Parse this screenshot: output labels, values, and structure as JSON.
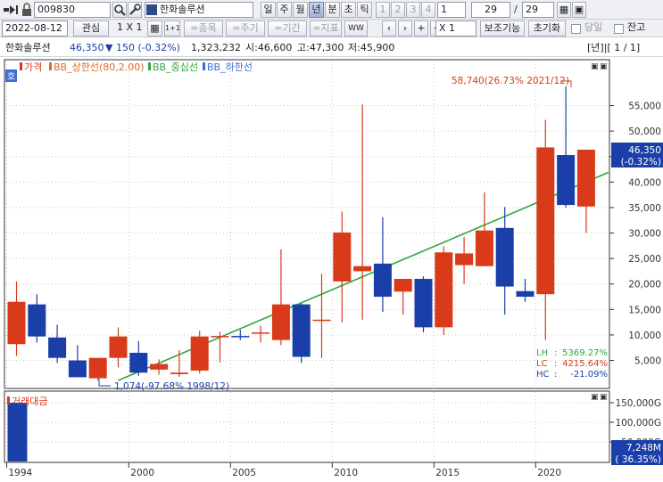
{
  "toolbar": {
    "code": "009830",
    "name": "한화솔루션",
    "periods": [
      "일",
      "주",
      "월",
      "년",
      "분",
      "초",
      "틱"
    ],
    "active_period": "년",
    "nums": [
      "1",
      "2",
      "3",
      "4",
      "1"
    ],
    "count": "29",
    "count_total": "29",
    "date": "2022-08-12",
    "interest": "관심",
    "layout": "1 X 1",
    "layout_small": "1+1",
    "btn_jongmok": "=종목",
    "btn_jugi": "=주기",
    "btn_gigan": "=기간",
    "btn_jipyo": "=지표",
    "ww": "WW",
    "scale": "X 1",
    "aux": "보조기능",
    "reset": "초기화",
    "chk_dangil": "당일",
    "chk_janggo": "잔고"
  },
  "info": {
    "name": "한화솔루션",
    "price": "46,350",
    "change": "▼ 150 (-0.32%)",
    "volume": "1,323,232",
    "open": "시:46,600",
    "high": "고:47,300",
    "low": "저:45,900",
    "page": "[년]|[ 1 / 1]"
  },
  "legend": {
    "price": "가격",
    "bb_upper": "BB_상한선(80,2.00)",
    "bb_mid": "BB_중심선",
    "bb_lower": "BB_하한선",
    "side_tag": "호"
  },
  "annotations": {
    "max": "58,740(26.73% 2021/12)",
    "min": "1,074(-97.68% 1998/12)",
    "lh_label": "LH",
    "lh_value": "5369.27%",
    "lc_label": "LC",
    "lc_value": "4215.64%",
    "hc_label": "HC",
    "hc_value": "-21.09%",
    "price_tag": "46,350",
    "price_tag_pct": "(-0.32%)",
    "vol_tag": "7,248M",
    "vol_tag_pct": "( 36.35%)"
  },
  "volume_panel": {
    "label": "거래대금"
  },
  "colors": {
    "up": "#d83a1a",
    "down": "#1a3fa8",
    "mid": "#2ea83a",
    "lower": "#3a6fd8",
    "upper": "#e06a2a"
  },
  "chart_data": {
    "type": "candlestick",
    "period": "yearly",
    "years": [
      1994,
      1995,
      1996,
      1997,
      1998,
      1999,
      2000,
      2001,
      2002,
      2003,
      2004,
      2005,
      2006,
      2007,
      2008,
      2009,
      2010,
      2011,
      2012,
      2013,
      2014,
      2015,
      2016,
      2017,
      2018,
      2019,
      2020,
      2021,
      2022
    ],
    "open": [
      8200,
      16000,
      9500,
      5000,
      1500,
      5500,
      6500,
      3200,
      2300,
      3000,
      9700,
      9800,
      10400,
      9000,
      16000,
      13000,
      20500,
      22500,
      24000,
      18500,
      21000,
      11500,
      23700,
      23500,
      31000,
      18600,
      18000,
      45300,
      35200
    ],
    "high": [
      20500,
      18000,
      12000,
      8000,
      4200,
      11500,
      8800,
      5200,
      7000,
      10800,
      10600,
      11000,
      11800,
      26800,
      16200,
      22000,
      34200,
      55200,
      33100,
      21000,
      21500,
      27400,
      29200,
      38000,
      35100,
      21000,
      52200,
      58740,
      45600
    ],
    "low": [
      5900,
      8500,
      4500,
      1800,
      1074,
      3600,
      2000,
      2200,
      1800,
      2400,
      4600,
      9000,
      8500,
      8000,
      4500,
      5500,
      12500,
      13000,
      14500,
      14000,
      10500,
      10000,
      20000,
      24000,
      14000,
      16500,
      9000,
      35000,
      30000
    ],
    "close": [
      16500,
      9700,
      5500,
      1700,
      5500,
      9700,
      2600,
      4300,
      2600,
      9700,
      9800,
      9700,
      10500,
      16000,
      5700,
      13000,
      30100,
      23500,
      17500,
      21000,
      11500,
      26200,
      26000,
      30500,
      19500,
      17500,
      46800,
      35500,
      46350
    ],
    "bb_mid_line": [
      {
        "year": 1999,
        "value": 1074
      },
      {
        "year": 2022,
        "value": 40500
      }
    ],
    "y_axis": {
      "ticks": [
        5000,
        10000,
        15000,
        20000,
        25000,
        30000,
        35000,
        40000,
        45000,
        50000,
        55000
      ]
    },
    "x_axis": {
      "ticks": [
        1994,
        2000,
        2005,
        2010,
        2015,
        2020
      ]
    },
    "volume": {
      "label": "거래대금",
      "values": [
        {
          "year": 1994,
          "value": 150000,
          "unit": "G"
        }
      ],
      "ticks": [
        "150,000G",
        "100,000G",
        "50,000G"
      ],
      "last_value": "7,248M",
      "last_change": "36.35%"
    },
    "last_price": 46350,
    "last_change_pct": "-0.32%"
  }
}
